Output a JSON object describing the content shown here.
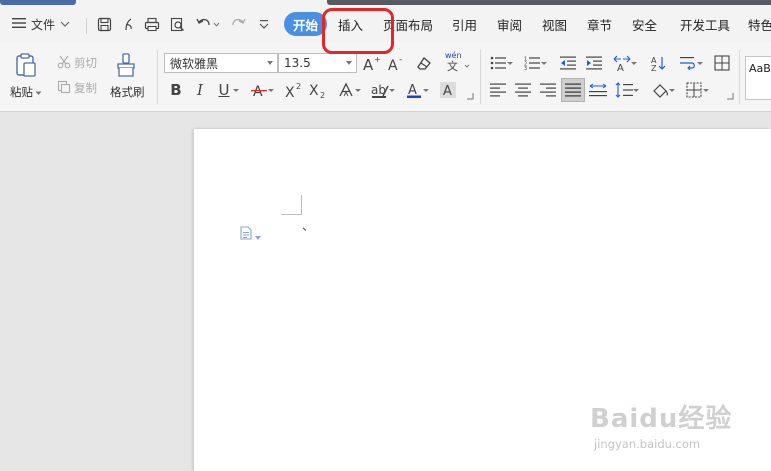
{
  "menu": {
    "file_label": "文件",
    "tabs": [
      {
        "label": "开始",
        "active": true
      },
      {
        "label": "插入",
        "active": false
      },
      {
        "label": "页面布局",
        "active": false
      },
      {
        "label": "引用",
        "active": false
      },
      {
        "label": "审阅",
        "active": false
      },
      {
        "label": "视图",
        "active": false
      },
      {
        "label": "章节",
        "active": false
      },
      {
        "label": "安全",
        "active": false
      },
      {
        "label": "开发工具",
        "active": false
      },
      {
        "label": "特色",
        "active": false
      }
    ]
  },
  "ribbon": {
    "paste_label": "粘贴",
    "cut_label": "剪切",
    "copy_label": "复制",
    "format_painter_label": "格式刷",
    "font_name": "微软雅黑",
    "font_size": "13.5",
    "pinyin_label": "wén",
    "style_preview": "AaB"
  },
  "document": {
    "cursor_text": "、"
  },
  "watermark": {
    "brand": "Baidu经验",
    "url": "jingyan.baidu.com"
  },
  "colors": {
    "accent": "#4a90e2",
    "highlight": "#e2262a",
    "font_color_bar": "#1f3fd1",
    "strike_color": "#e2262a"
  }
}
